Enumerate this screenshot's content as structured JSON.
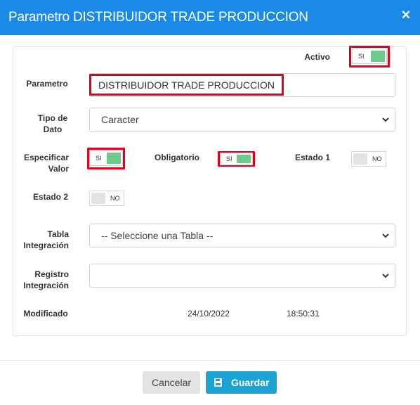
{
  "dialog": {
    "title": "Parametro DISTRIBUIDOR TRADE PRODUCCION",
    "close_icon": "close-icon"
  },
  "form": {
    "activo": {
      "label": "Activo",
      "value": "SI",
      "on": true
    },
    "parametro": {
      "label": "Parametro",
      "value": "DISTRIBUIDOR TRADE PRODUCCION"
    },
    "tipo_dato": {
      "label_line1": "Tipo de",
      "label_line2": "Dato",
      "value": "Caracter"
    },
    "especificar_valor": {
      "label_line1": "Especificar",
      "label_line2": "Valor",
      "value": "SI",
      "on": true
    },
    "obligatorio": {
      "label": "Obligatorio",
      "value": "SI",
      "on": true
    },
    "estado1": {
      "label": "Estado 1",
      "value": "NO",
      "on": false
    },
    "estado2": {
      "label": "Estado 2",
      "value": "NO",
      "on": false
    },
    "tabla_integracion": {
      "label_line1": "Tabla",
      "label_line2": "Integración",
      "value": "-- Seleccione una Tabla --"
    },
    "registro_integracion": {
      "label_line1": "Registro",
      "label_line2": "Integración",
      "value": ""
    },
    "modificado": {
      "label": "Modificado",
      "date": "24/10/2022",
      "time": "18:50:31"
    }
  },
  "footer": {
    "cancel_label": "Cancelar",
    "save_label": "Guardar",
    "save_icon": "save-icon"
  },
  "colors": {
    "header": "#1a8ae6",
    "toggle_on": "#6cca8c",
    "highlight": "#e4001b",
    "save_button": "#1aa3d4"
  }
}
